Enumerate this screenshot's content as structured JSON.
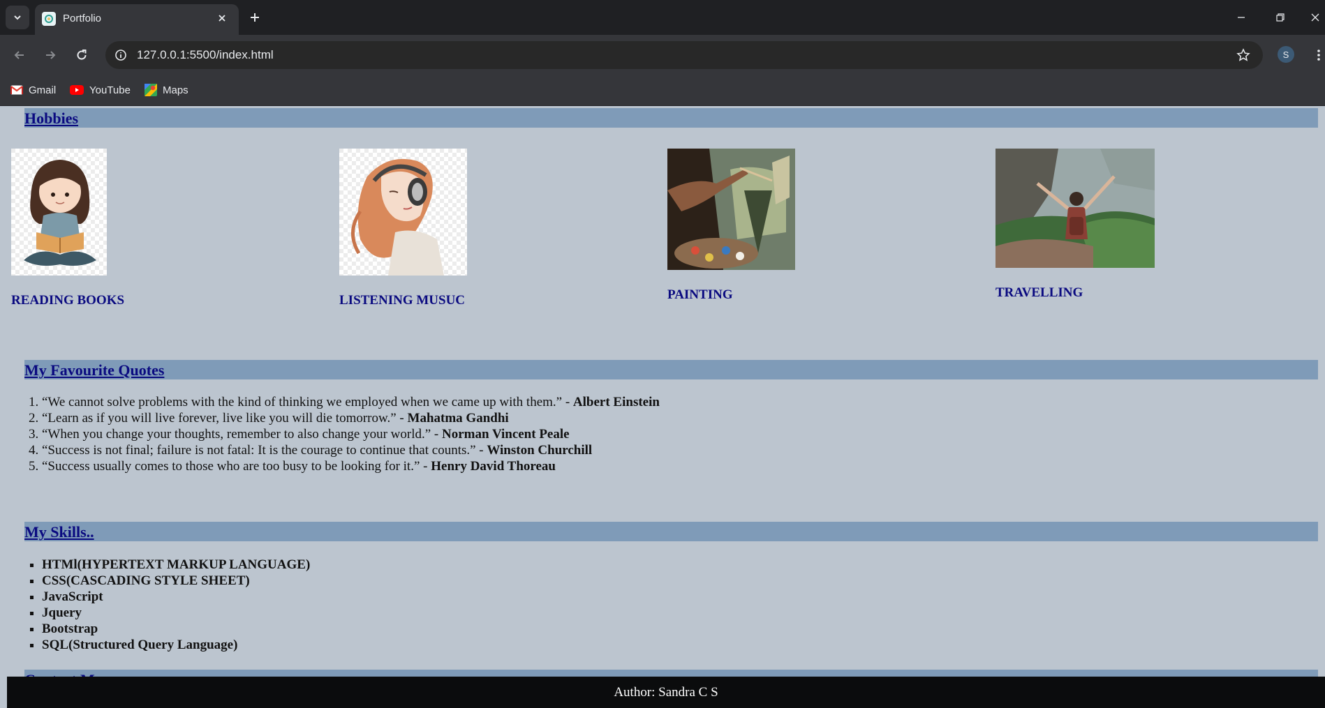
{
  "browser": {
    "tab_title": "Portfolio",
    "url": "127.0.0.1:5500/index.html",
    "profile_initial": "S",
    "bookmarks": [
      {
        "label": "Gmail",
        "icon": "gmail-icon"
      },
      {
        "label": "YouTube",
        "icon": "youtube-icon"
      },
      {
        "label": "Maps",
        "icon": "maps-icon"
      }
    ]
  },
  "page": {
    "hobbies": {
      "heading": "Hobbies",
      "items": [
        {
          "label": "READING BOOKS"
        },
        {
          "label": "LISTENING MUSUC"
        },
        {
          "label": "PAINTING"
        },
        {
          "label": "TRAVELLING"
        }
      ]
    },
    "quotes": {
      "heading": "My Favourite Quotes",
      "items": [
        {
          "text": "“We cannot solve problems with the kind of thinking we employed when we came up with them.” - ",
          "author": "Albert Einstein"
        },
        {
          "text": "“Learn as if you will live forever, live like you will die tomorrow.” - ",
          "author": "Mahatma Gandhi"
        },
        {
          "text": "“When you change your thoughts, remember to also change your world.” - ",
          "author": "Norman Vincent Peale"
        },
        {
          "text": "“Success is not final; failure is not fatal: It is the courage to continue that counts.” - ",
          "author": "Winston Churchill"
        },
        {
          "text": "“Success usually comes to those who are too busy to be looking for it.” - ",
          "author": "Henry David Thoreau"
        }
      ]
    },
    "skills": {
      "heading": "My Skills..",
      "items": [
        "HTMl(HYPERTEXT MARKUP LANGUAGE)",
        "CSS(CASCADING STYLE SHEET)",
        "JavaScript",
        "Jquery",
        "Bootstrap",
        "SQL(Structured Query Language)"
      ]
    },
    "contact": {
      "heading": "Contact Me"
    },
    "footer": "Author: Sandra C S"
  },
  "colors": {
    "page_bg": "#bcc5cf",
    "section_bar": "#7f9bb8",
    "heading_text": "#0a0a80",
    "footer_bg": "#0b0c0d"
  }
}
